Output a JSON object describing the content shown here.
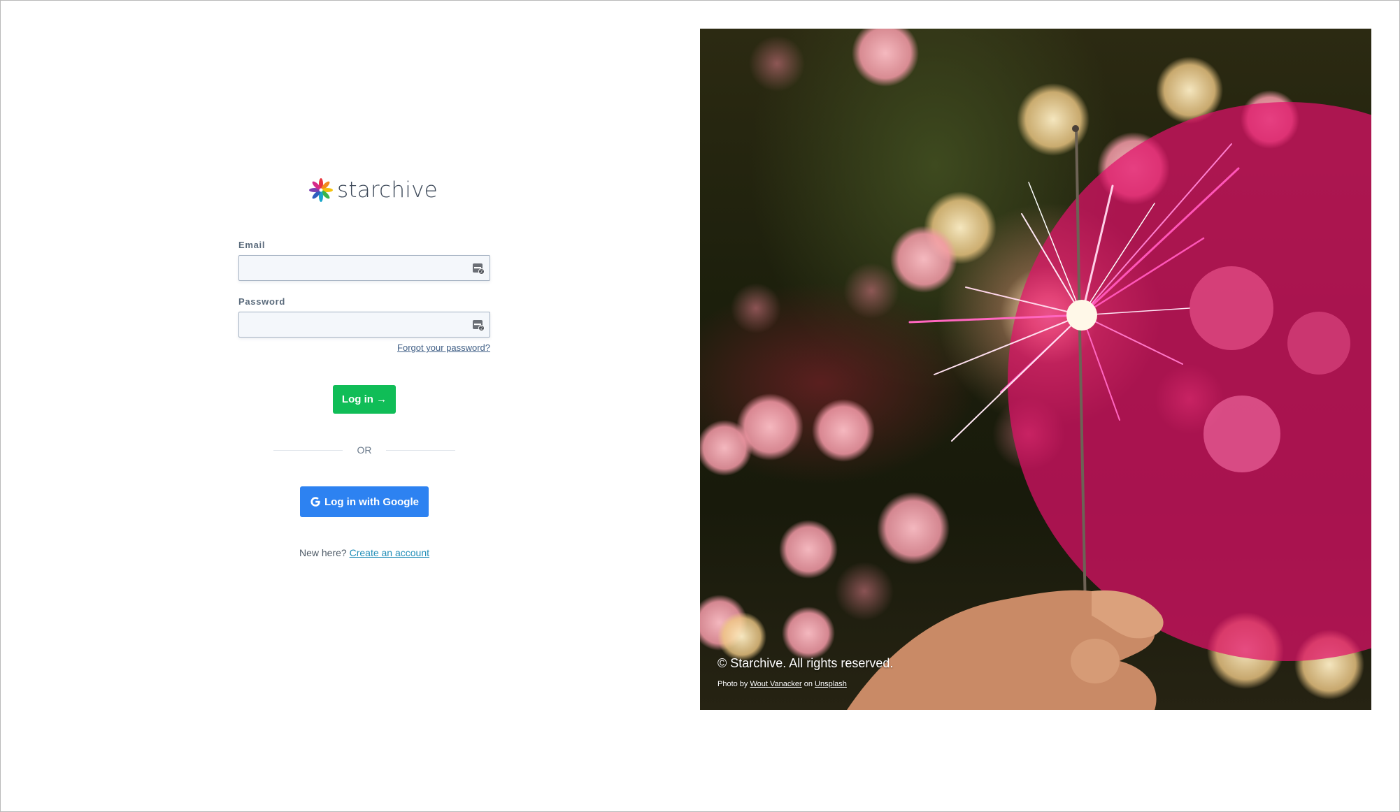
{
  "brand": {
    "name": "starchive",
    "logo_icon": "starchive-flower-icon"
  },
  "login_form": {
    "email_label": "Email",
    "email_value": "",
    "email_placeholder": "",
    "password_label": "Password",
    "password_value": "",
    "password_placeholder": "",
    "field_icon": "password-manager-icon",
    "forgot_password": "Forgot your password?",
    "login_button": "Log in →",
    "divider_text": "OR",
    "google_button": "Log in with Google",
    "google_icon": "google-g-icon",
    "signup_prompt": "New here?",
    "signup_link": "Create an account"
  },
  "hero": {
    "image_subject": "sparkler-photo",
    "copyright": "© Starchive. All rights reserved.",
    "credit_prefix": "Photo by",
    "credit_author": "Wout Vanacker",
    "credit_mid": "on",
    "credit_source": "Unsplash"
  },
  "colors": {
    "login_green": "#10bd57",
    "google_blue": "#2d82f1",
    "link_teal": "#1f8db7",
    "brand_magenta": "#e0106a"
  }
}
